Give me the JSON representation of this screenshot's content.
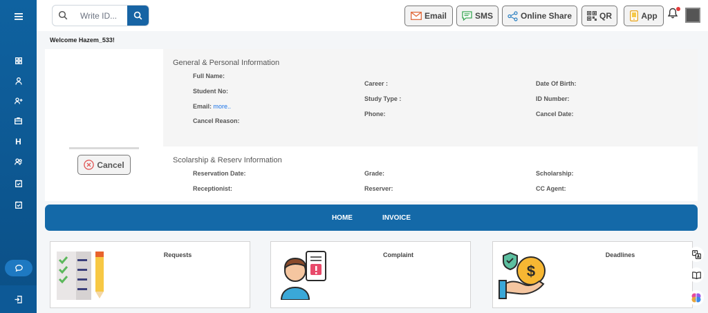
{
  "search": {
    "placeholder": "Write ID..."
  },
  "toolbar": {
    "email": "Email",
    "sms": "SMS",
    "online_share": "Online Share",
    "qr": "QR",
    "app": "App"
  },
  "welcome": "Welcome Hazem_533!",
  "profile": {
    "cancel_label": "Cancel"
  },
  "general": {
    "title": "General & Personal Information",
    "full_name": "Full Name:",
    "student_no": "Student No:",
    "email": "Email:",
    "email_more": "more..",
    "cancel_reason": "Cancel Reason:",
    "career": "Career :",
    "study_type": "Study Type :",
    "phone": "Phone:",
    "dob": "Date Of Birth:",
    "id_number": "ID Number:",
    "cancel_date": "Cancel Date:"
  },
  "reserv": {
    "title": "Scolarship & Reserv Information",
    "reservation_date": "Reservation Date:",
    "receptionist": "Receptionist:",
    "grade": "Grade:",
    "reserver": "Reserver:",
    "scholarship": "Scholarship:",
    "cc_agent": "CC Agent:"
  },
  "nav": {
    "home": "HOME",
    "invoice": "INVOICE"
  },
  "tiles": {
    "requests": "Requests",
    "complaint": "Complaint",
    "deadlines": "Deadlines"
  },
  "colors": {
    "primary": "#1469a8",
    "sidebar": "#0f62a0",
    "accent_red": "#e23b3b"
  }
}
